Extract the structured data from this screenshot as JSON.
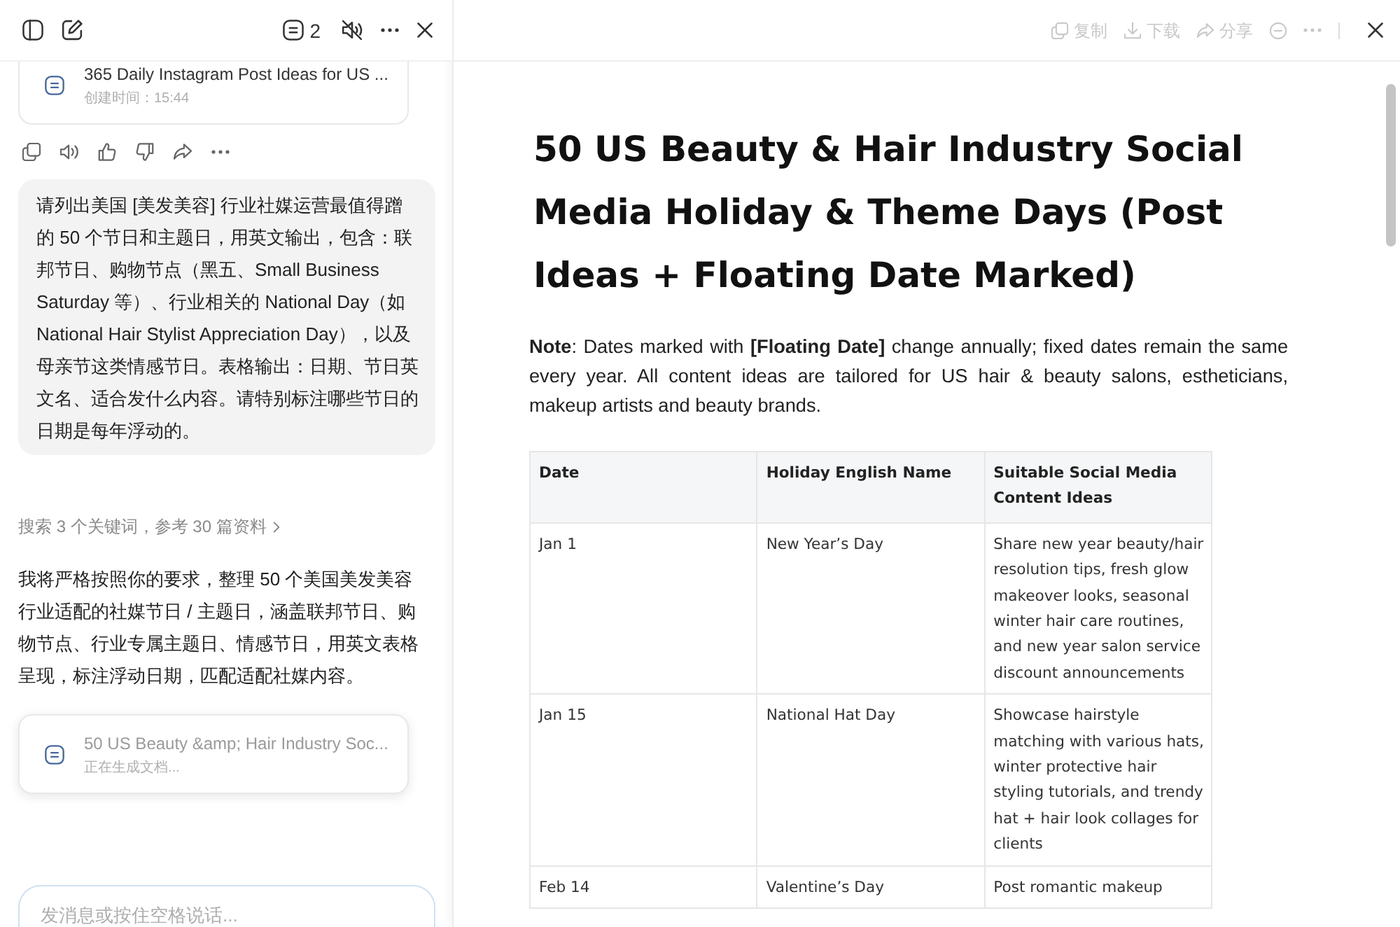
{
  "chat_header": {
    "doc_count": "2"
  },
  "chat": {
    "history_card": {
      "title": "365 Daily Instagram Post Ideas for US ...",
      "subtitle": "创建时间：15:44",
      "generating": false
    },
    "user_message": "请列出美国 [美发美容] 行业社媒运营最值得蹭的 50 个节日和主题日，用英文输出，包含：联邦节日、购物节点（黑五、Small Business Saturday 等）、行业相关的 National Day（如 National Hair Stylist Appreciation Day），以及母亲节这类情感节日。表格输出：日期、节日英文名、适合发什么内容。请特别标注哪些节日的日期是每年浮动的。",
    "search_summary": "搜索 3 个关键词，参考 30 篇资料",
    "assistant_message": "我将严格按照你的要求，整理 50 个美国美发美容行业适配的社媒节日 / 主题日，涵盖联邦节日、购物节点、行业专属主题日、情感节日，用英文表格呈现，标注浮动日期，匹配适配社媒内容。",
    "doc_card": {
      "title": "50 US Beauty &amp; Hair Industry Soc...",
      "subtitle": "正在生成文档...",
      "generating": true
    }
  },
  "composer": {
    "placeholder": "发消息或按住空格说话..."
  },
  "document": {
    "toolbar": [
      {
        "kind": "copy",
        "label": "复制",
        "disabled": true
      },
      {
        "kind": "download",
        "label": "下载",
        "disabled": true
      },
      {
        "kind": "share",
        "label": "分享",
        "disabled": true
      },
      {
        "kind": "minus",
        "disabled": true
      },
      {
        "kind": "more",
        "disabled": true
      }
    ],
    "title": "50 US Beauty & Hair Industry Social Media Holiday & Theme Days (Post Ideas + Floating Date Marked)",
    "note": "**Note**: Dates marked with **[Floating Date]** change annually; fixed dates remain the same every year. All content ideas are tailored for US hair & beauty salons, estheticians, makeup artists and beauty brands.",
    "table": {
      "columns": [
        "Date",
        "Holiday English Name",
        "Suitable Social Media Content Ideas"
      ],
      "rows": [
        [
          "Jan 1",
          "New Year’s Day",
          "Share new year beauty/hair resolution tips, fresh glow makeover looks, seasonal winter hair care routines, and new year salon service discount announcements"
        ],
        [
          "Jan 15",
          "National Hat Day",
          "Showcase hairstyle matching with various hats, winter protective hair styling tutorials, and trendy hat + hair look collages for clients"
        ],
        [
          "Feb 14",
          "Valentine’s Day",
          "Post romantic makeup"
        ]
      ]
    }
  }
}
